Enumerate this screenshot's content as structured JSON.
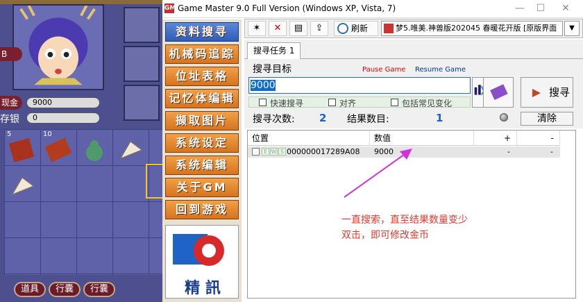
{
  "window": {
    "title": "Game Master 9.0 Full Version (Windows XP, Vista, 7)",
    "app_icon_label": "GM",
    "minimize": "—",
    "maximize": "☐",
    "close": "✕"
  },
  "game": {
    "gold_label": "现金",
    "gold_value": "9000",
    "silver_label": "存银",
    "silver_value": "0",
    "side_label": "B",
    "item_counts": [
      "5",
      "10"
    ],
    "bottom_buttons": [
      "道具",
      "行囊",
      "行囊"
    ]
  },
  "menu": {
    "items": [
      "资料搜寻",
      "机械码追踪",
      "位址表格",
      "记忆体编辑",
      "撷取图片",
      "系统设定",
      "系统编辑",
      "关于GM",
      "回到游戏"
    ],
    "logo_text": "精 訊"
  },
  "toolbar": {
    "refresh_label": "刷新",
    "target_process": "梦5.唯美.神兽版202045 春暖花开版 [原版界面",
    "dropdown_arrow": "▼"
  },
  "search": {
    "tab_label": "搜寻任务 1",
    "target_label": "搜寻目标",
    "pause_label": "Pause Game",
    "resume_label": "Resume Game",
    "input_value": "9000",
    "fast_search_label": "快速搜寻",
    "align_label": "对齐",
    "common_changes_label": "包括常见变化",
    "search_button": "搜寻",
    "count_label": "搜寻次数:",
    "count_value": "2",
    "results_label": "结果数目:",
    "results_value": "1",
    "clear_button": "清除"
  },
  "results": {
    "columns": [
      "位置",
      "数值",
      "+",
      "-"
    ],
    "rows": [
      {
        "address": "000000017289A08",
        "value": "9000",
        "plus": "-",
        "minus": "-",
        "flags": [
          "E",
          "W",
          "S"
        ]
      }
    ]
  },
  "annotation": {
    "line1": "一直搜索，直至结果数量变少",
    "line2": "双击，即可修改金币",
    "color": "#e8372d"
  }
}
